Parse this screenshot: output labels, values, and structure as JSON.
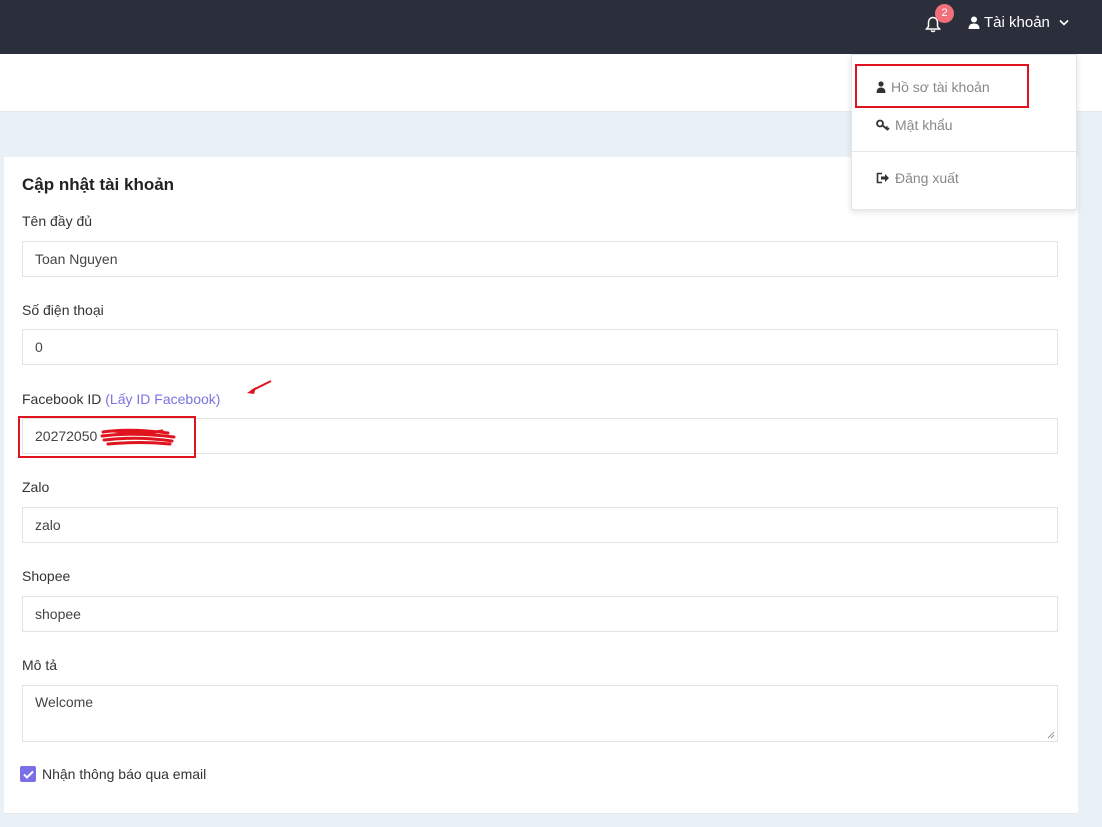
{
  "topbar": {
    "notification_count": "2",
    "account_label": "Tài khoản"
  },
  "account_dropdown": {
    "items": [
      {
        "label": "Hồ sơ tài khoản",
        "icon": "user-icon"
      },
      {
        "label": "Mật khẩu",
        "icon": "key-icon"
      },
      {
        "label": "Đăng xuất",
        "icon": "logout-icon"
      }
    ]
  },
  "form": {
    "title": "Cập nhật tài khoản",
    "full_name": {
      "label": "Tên đầy đủ",
      "value": "Toan Nguyen"
    },
    "phone": {
      "label": "Số điện thoại",
      "value": "0"
    },
    "facebook": {
      "label": "Facebook ID",
      "link": "(Lấy ID Facebook)",
      "value": "20272050"
    },
    "zalo": {
      "label": "Zalo",
      "value": "zalo"
    },
    "shopee": {
      "label": "Shopee",
      "value": "shopee"
    },
    "description": {
      "label": "Mô tả",
      "value": "Welcome"
    },
    "email_notify": {
      "label": "Nhận thông báo qua email",
      "checked": true
    }
  },
  "colors": {
    "topbar": "#2b2f3b",
    "accent": "#7a73e0",
    "badge": "#f1707a",
    "annotation": "#e0141e"
  }
}
